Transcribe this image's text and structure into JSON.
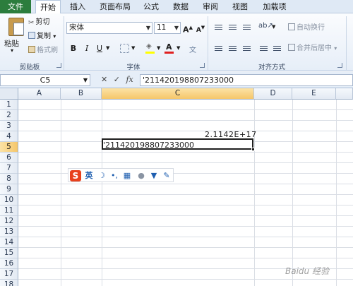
{
  "tabs": [
    {
      "label": "文件",
      "active": false,
      "file": true
    },
    {
      "label": "开始",
      "active": true
    },
    {
      "label": "插入",
      "active": false
    },
    {
      "label": "页面布局",
      "active": false
    },
    {
      "label": "公式",
      "active": false
    },
    {
      "label": "数据",
      "active": false
    },
    {
      "label": "审阅",
      "active": false
    },
    {
      "label": "视图",
      "active": false
    },
    {
      "label": "加载项",
      "active": false
    }
  ],
  "ribbon": {
    "clipboard": {
      "paste_label": "粘贴",
      "cut_label": "剪切",
      "copy_label": "复制",
      "copy_dd": "▾",
      "format_painter_label": "格式刷",
      "group_label": "剪贴板"
    },
    "font": {
      "font_name": "宋体",
      "font_size": "11",
      "grow_label": "A",
      "shrink_label": "A",
      "bold_label": "B",
      "italic_label": "I",
      "underline_label": "U",
      "font_color_label": "A",
      "group_label": "字体"
    },
    "alignment": {
      "wrap_text_label": "自动换行",
      "merge_center_label": "合并后居中",
      "merge_dd": "▾",
      "group_label": "对齐方式"
    }
  },
  "formula_bar": {
    "name_box": "C5",
    "fx_label": "fx",
    "formula": "'211420198807233000"
  },
  "sheet": {
    "columns": [
      "A",
      "B",
      "C",
      "D",
      "E"
    ],
    "rows": [
      "1",
      "2",
      "3",
      "4",
      "5",
      "6",
      "7",
      "8",
      "9",
      "10",
      "11",
      "12",
      "13",
      "14",
      "15",
      "16",
      "17",
      "18"
    ],
    "selected_column": "C",
    "selected_row": "5",
    "cells": {
      "C4": "2.1142E+17",
      "C5": "'211420198807233000"
    }
  },
  "ime_toolbar": {
    "logo": "S",
    "mode_label": "英",
    "moon": "☽",
    "punct": "•,",
    "keyboard": "▦",
    "user": "●",
    "skin": "▼",
    "tools": "✎"
  },
  "watermark": "Baidu 经验",
  "colors": {
    "file_tab": "#2c7d3d",
    "selection_header": "#f5c66a",
    "ime_logo": "#e8411d",
    "ime_text": "#1f5fb0",
    "font_color_bar": "#e02020",
    "highlight_bar": "#ffff00"
  }
}
